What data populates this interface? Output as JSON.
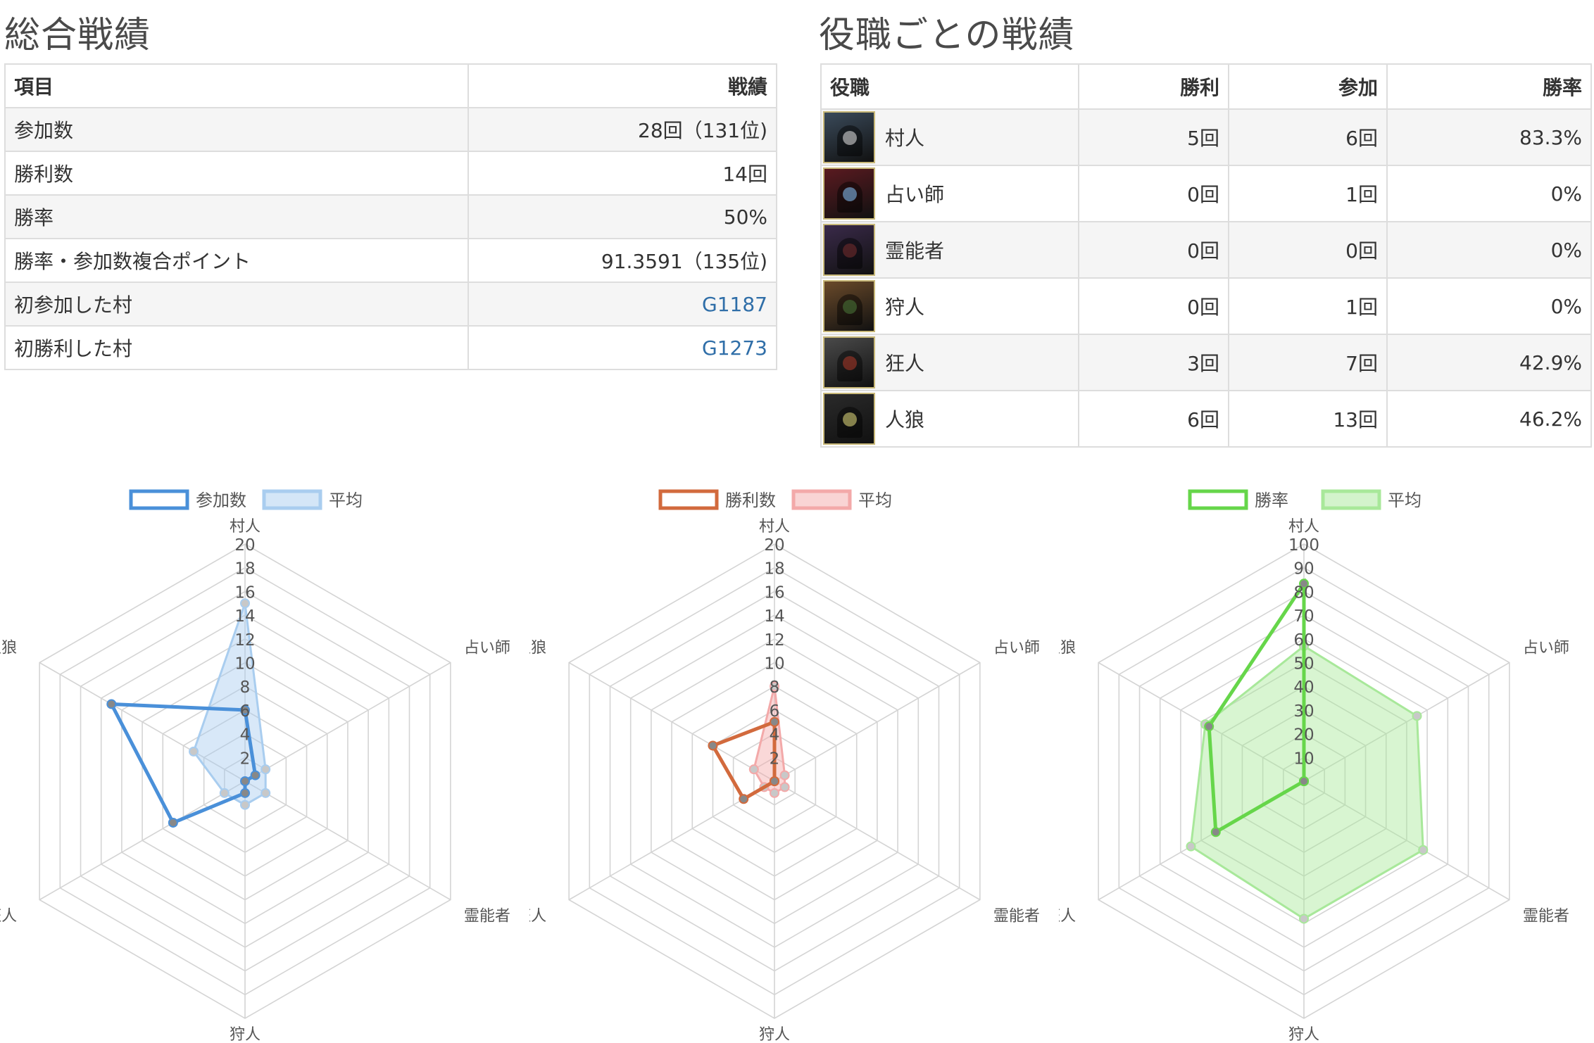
{
  "overall": {
    "title": "総合戦績",
    "headers": [
      "項目",
      "戦績"
    ],
    "rows": [
      {
        "label": "参加数",
        "value": "28回（131位)",
        "link": false
      },
      {
        "label": "勝利数",
        "value": "14回",
        "link": false
      },
      {
        "label": "勝率",
        "value": "50%",
        "link": false
      },
      {
        "label": "勝率・参加数複合ポイント",
        "value": "91.3591（135位)",
        "link": false
      },
      {
        "label": "初参加した村",
        "value": "G1187",
        "link": true
      },
      {
        "label": "初勝利した村",
        "value": "G1273",
        "link": true
      }
    ]
  },
  "roles": {
    "title": "役職ごとの戦績",
    "headers": [
      "役職",
      "勝利",
      "参加",
      "勝率"
    ],
    "rows": [
      {
        "role": "村人",
        "wins": "5回",
        "plays": "6回",
        "rate": "83.3%",
        "icon": "villager-icon",
        "icon_bg": "#3a4a5a",
        "icon_glow": "#e8e8e8"
      },
      {
        "role": "占い師",
        "wins": "0回",
        "plays": "1回",
        "rate": "0%",
        "icon": "seer-icon",
        "icon_bg": "#5a1a20",
        "icon_glow": "#8ac8ff"
      },
      {
        "role": "霊能者",
        "wins": "0回",
        "plays": "0回",
        "rate": "0%",
        "icon": "medium-icon",
        "icon_bg": "#3a2a4a",
        "icon_glow": "#7a3030"
      },
      {
        "role": "狩人",
        "wins": "0回",
        "plays": "1回",
        "rate": "0%",
        "icon": "hunter-icon",
        "icon_bg": "#6a4a2a",
        "icon_glow": "#4a7a3a"
      },
      {
        "role": "狂人",
        "wins": "3回",
        "plays": "7回",
        "rate": "42.9%",
        "icon": "madman-icon",
        "icon_bg": "#4a4a4a",
        "icon_glow": "#b03a2a"
      },
      {
        "role": "人狼",
        "wins": "6回",
        "plays": "13回",
        "rate": "46.2%",
        "icon": "werewolf-icon",
        "icon_bg": "#2a2a2a",
        "icon_glow": "#e8e080"
      }
    ]
  },
  "chart_data": [
    {
      "type": "radar",
      "labels": [
        "村人",
        "占い師",
        "霊能者",
        "狩人",
        "狂人",
        "人狼"
      ],
      "rmax": 20,
      "ticks": [
        2,
        4,
        6,
        8,
        10,
        12,
        14,
        16,
        18,
        20
      ],
      "legend_position": "top",
      "series": [
        {
          "name": "参加数",
          "values": [
            6,
            1,
            0,
            1,
            7,
            13
          ],
          "color": "#4a90d9",
          "fill": false
        },
        {
          "name": "平均",
          "values": [
            15,
            2,
            2,
            2,
            2,
            5
          ],
          "color": "#a9cdef",
          "fill": true
        }
      ]
    },
    {
      "type": "radar",
      "labels": [
        "村人",
        "占い師",
        "霊能者",
        "狩人",
        "狂人",
        "人狼"
      ],
      "rmax": 20,
      "ticks": [
        2,
        4,
        6,
        8,
        10,
        12,
        14,
        16,
        18,
        20
      ],
      "legend_position": "top",
      "series": [
        {
          "name": "勝利数",
          "values": [
            5,
            0,
            0,
            0,
            3,
            6
          ],
          "color": "#d26a3d",
          "fill": false
        },
        {
          "name": "平均",
          "values": [
            8,
            1,
            1,
            1,
            1,
            2
          ],
          "color": "#f3a9a9",
          "fill": true
        }
      ]
    },
    {
      "type": "radar",
      "labels": [
        "村人",
        "占い師",
        "霊能者",
        "狩人",
        "狂人",
        "人狼"
      ],
      "rmax": 100,
      "ticks": [
        10,
        20,
        30,
        40,
        50,
        60,
        70,
        80,
        90,
        100
      ],
      "legend_position": "top",
      "series": [
        {
          "name": "勝率",
          "values": [
            83.3,
            0,
            0,
            0,
            42.9,
            46.2
          ],
          "color": "#66d64a",
          "fill": false
        },
        {
          "name": "平均",
          "values": [
            57,
            55,
            58,
            58,
            55,
            48
          ],
          "color": "#a8e89a",
          "fill": true
        }
      ]
    }
  ]
}
